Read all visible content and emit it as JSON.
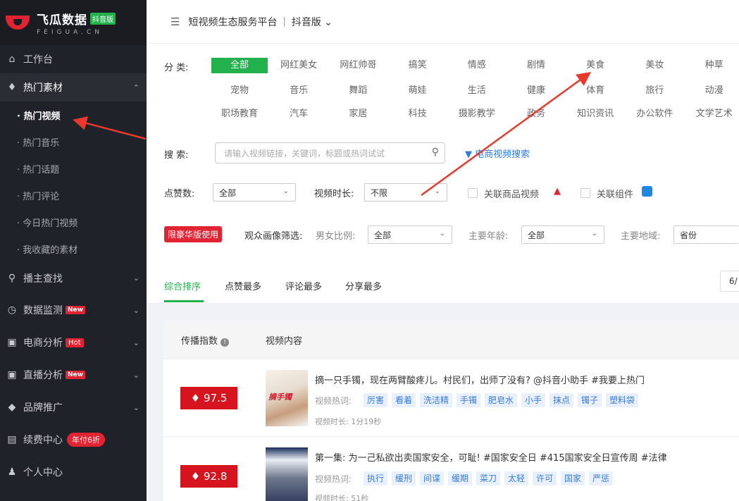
{
  "brand": {
    "name": "飞瓜数据",
    "badge": "抖音版",
    "sub": "FEIGUA.CN"
  },
  "sidebar": {
    "items": [
      {
        "label": "工作台"
      },
      {
        "label": "热门素材"
      },
      {
        "label": "播主查找"
      },
      {
        "label": "数据监测",
        "tag": "New"
      },
      {
        "label": "电商分析",
        "tag": "Hot"
      },
      {
        "label": "直播分析",
        "tag": "New"
      },
      {
        "label": "品牌推广"
      },
      {
        "label": "续费中心",
        "tag": "年付6折"
      },
      {
        "label": "个人中心"
      }
    ],
    "sub_items": [
      "· 热门视频",
      "· 热门音乐",
      "· 热门话题",
      "· 热门评论",
      "· 今日热门视频",
      "· 我收藏的素材"
    ]
  },
  "header": {
    "title": "短视频生态服务平台",
    "separator": "|",
    "version": "抖音版"
  },
  "filters": {
    "category_label": "分 类:",
    "categories": [
      [
        "全部",
        "网红美女",
        "网红帅哥",
        "搞笑",
        "情感",
        "剧情",
        "美食",
        "美妆",
        "种草"
      ],
      [
        "宠物",
        "音乐",
        "舞蹈",
        "萌娃",
        "生活",
        "健康",
        "体育",
        "旅行",
        "动漫"
      ],
      [
        "职场教育",
        "汽车",
        "家居",
        "科技",
        "摄影教学",
        "政务",
        "知识资讯",
        "办公软件",
        "文学艺术"
      ]
    ],
    "search_label": "搜 索:",
    "search_placeholder": "请输入视频链接，关键词，标题或热词试试",
    "ecom_search": "电商视频搜索",
    "likes_label": "点赞数:",
    "likes_value": "全部",
    "duration_label": "视频时长:",
    "duration_value": "不限",
    "related_goods": "关联商品视频",
    "related_component": "关联组件",
    "limit_badge": "限豪华版使用",
    "audience_label": "观众画像筛选:",
    "gender_label": "男女比例:",
    "gender_value": "全部",
    "age_label": "主要年龄:",
    "age_value": "全部",
    "region_label": "主要地域:",
    "region_value": "省份"
  },
  "sort_tabs": [
    "综合排序",
    "点赞最多",
    "评论最多",
    "分享最多"
  ],
  "pager_value": "6/",
  "list": {
    "col_index": "传播指数",
    "col_content": "视频内容",
    "hot_words_label": "视频热词:",
    "rows": [
      {
        "score": "97.5",
        "title": "摘一只手镯，现在两臂酸疼儿。村民们，出师了没有? @抖音小助手 #我要上热门",
        "thumb_text": "摘手镯",
        "tags": [
          "厉害",
          "看着",
          "洗洁精",
          "手镯",
          "肥皂水",
          "小手",
          "抹点",
          "镯子",
          "塑料袋"
        ],
        "duration": "视频时长: 1分19秒"
      },
      {
        "score": "92.8",
        "title": "第一集: 为一己私欲出卖国家安全，可耻! #国家安全日 #415国家安全日宣传周 #法律",
        "thumb_text": "",
        "tags": [
          "执行",
          "缓刑",
          "间谍",
          "缓期",
          "菜刀",
          "太轻",
          "许可",
          "国家",
          "严惩"
        ],
        "duration": "视频时长: 51秒"
      }
    ]
  }
}
